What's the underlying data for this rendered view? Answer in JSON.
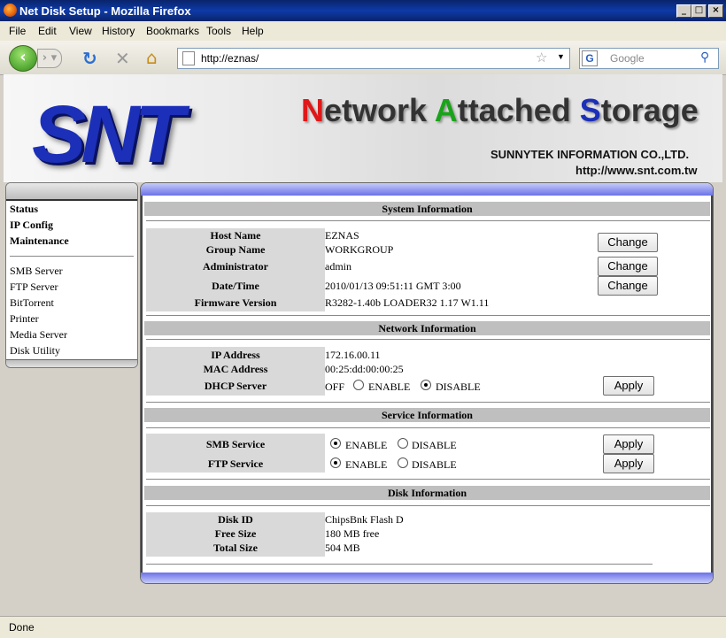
{
  "window": {
    "title": "Net Disk Setup - Mozilla Firefox"
  },
  "menu": [
    "File",
    "Edit",
    "View",
    "History",
    "Bookmarks",
    "Tools",
    "Help"
  ],
  "nav": {
    "url": "http://eznas/",
    "search_placeholder": "Google"
  },
  "header": {
    "brand": "SNT",
    "title_parts": [
      {
        "t": "N",
        "c": "#e01818"
      },
      {
        "t": "etwork ",
        "c": "#333333"
      },
      {
        "t": "A",
        "c": "#1aa31a"
      },
      {
        "t": "ttached ",
        "c": "#333333"
      },
      {
        "t": "S",
        "c": "#1c2fb8"
      },
      {
        "t": "torage",
        "c": "#333333"
      }
    ],
    "company": "SUNNYTEK INFORMATION CO.,LTD.",
    "site": "http://www.snt.com.tw"
  },
  "sidebar": {
    "items": [
      "Status",
      "IP Config",
      "Maintenance",
      "SMB Server",
      "FTP Server",
      "BitTorrent",
      "Printer",
      "Media Server",
      "Disk Utility"
    ]
  },
  "system": {
    "header": "System Information",
    "labels": [
      "Host Name",
      "Group Name",
      "Administrator",
      "Date/Time",
      "Firmware Version"
    ],
    "values": [
      "EZNAS",
      "WORKGROUP",
      "admin",
      "2010/01/13 09:51:11 GMT 3:00",
      "R3282-1.40b LOADER32 1.17 W1.11"
    ],
    "change_label": "Change"
  },
  "network": {
    "header": "Network Information",
    "labels": [
      "IP Address",
      "MAC Address",
      "DHCP Server"
    ],
    "values": [
      "172.16.00.11",
      "00:25:dd:00:00:25"
    ],
    "dhcp_status": "OFF",
    "enable": "ENABLE",
    "disable": "DISABLE",
    "apply_label": "Apply"
  },
  "service": {
    "header": "Service Information",
    "labels": [
      "SMB Service",
      "FTP Service"
    ],
    "enable": "ENABLE",
    "disable": "DISABLE",
    "apply_label": "Apply"
  },
  "disk": {
    "header": "Disk Information",
    "labels": [
      "Disk ID",
      "Free Size",
      "Total Size"
    ],
    "values": [
      "ChipsBnk Flash D",
      "180 MB free",
      "504 MB"
    ]
  },
  "status": {
    "text": "Done"
  }
}
